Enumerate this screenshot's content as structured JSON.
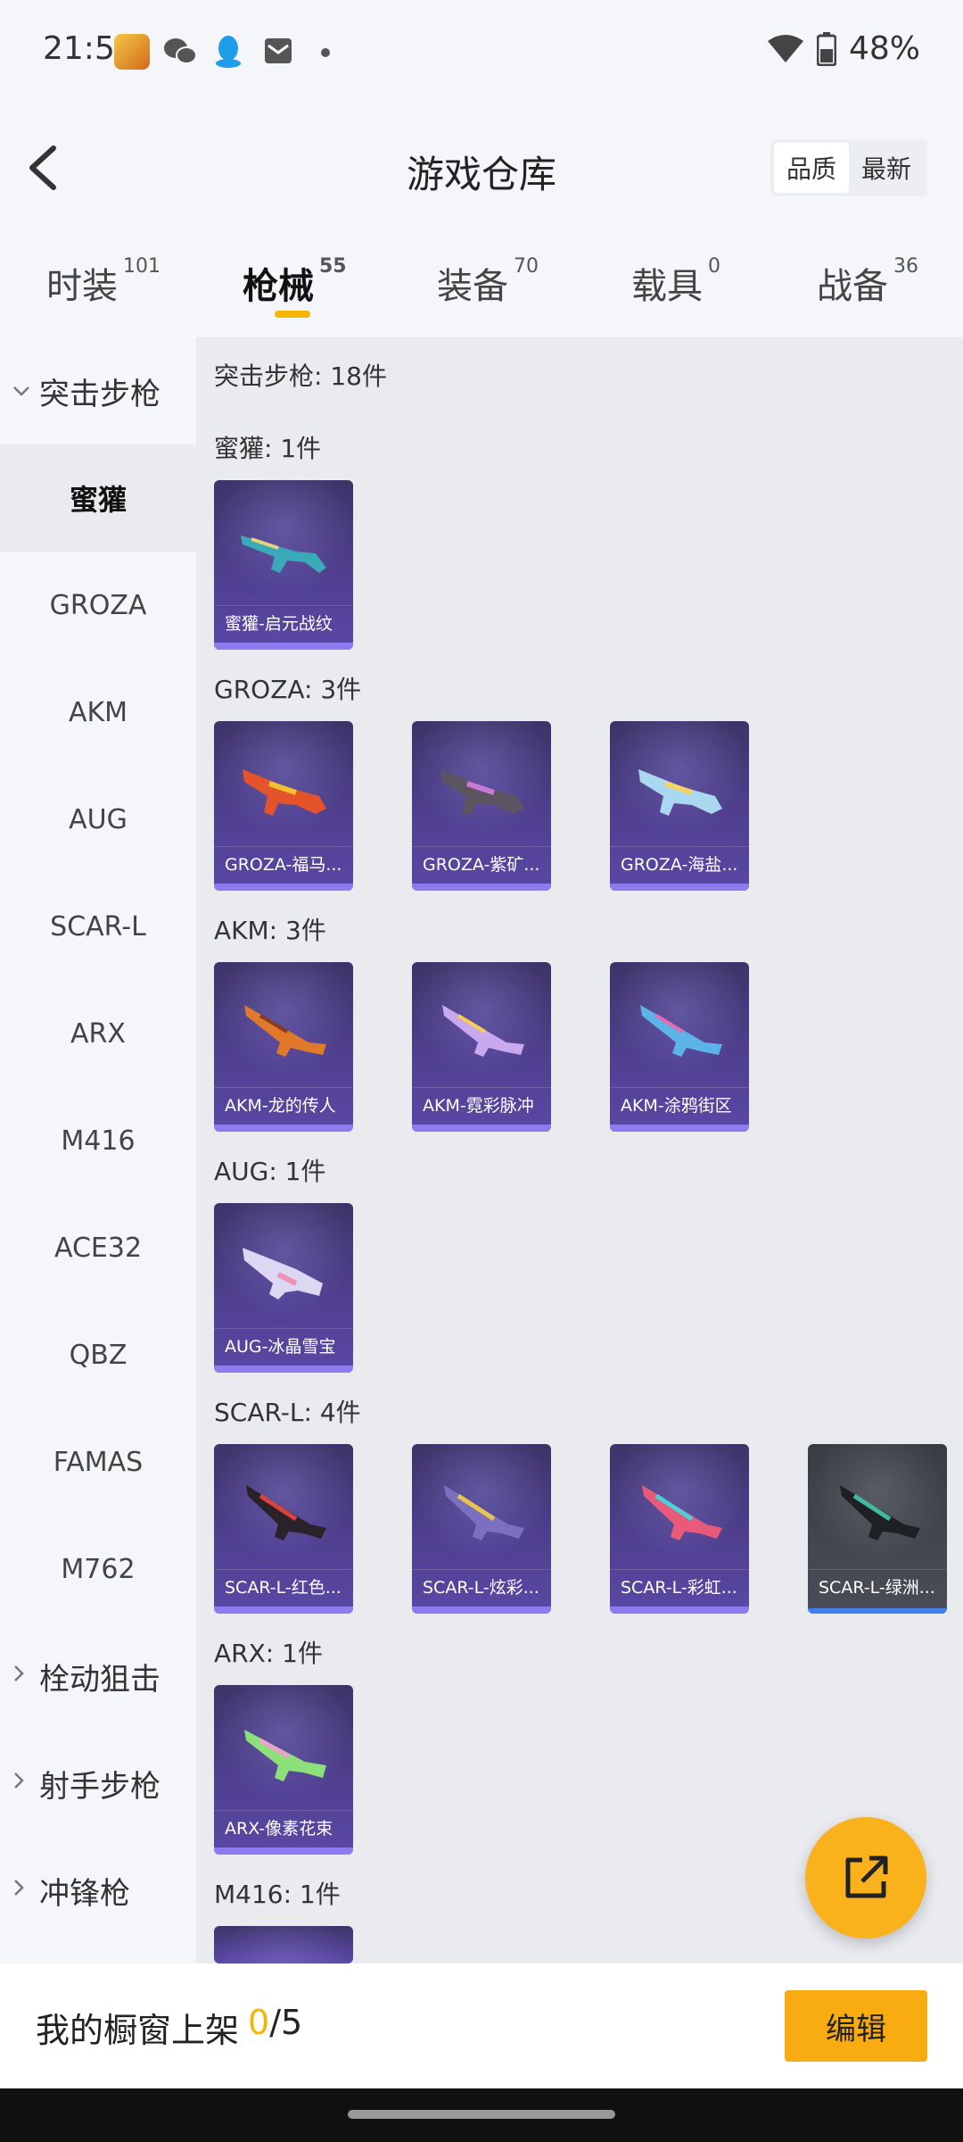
{
  "status_bar": {
    "time": "21:51",
    "battery": "48%"
  },
  "header": {
    "title": "游戏仓库",
    "sort_options": [
      "品质",
      "最新"
    ]
  },
  "tabs": [
    {
      "label": "时装",
      "count": "101"
    },
    {
      "label": "枪械",
      "count": "55"
    },
    {
      "label": "装备",
      "count": "70"
    },
    {
      "label": "载具",
      "count": "0"
    },
    {
      "label": "战备",
      "count": "36"
    }
  ],
  "sidebar": {
    "expanded_category": "突击步枪",
    "sub_items": [
      "蜜獾",
      "GROZA",
      "AKM",
      "AUG",
      "SCAR-L",
      "ARX",
      "M416",
      "ACE32",
      "QBZ",
      "FAMAS",
      "M762"
    ],
    "collapsed_categories": [
      "栓动狙击",
      "射手步枪",
      "冲锋枪"
    ]
  },
  "main": {
    "summary": "突击步枪: 18件",
    "sections": [
      {
        "label": "蜜獾: 1件",
        "items": [
          "蜜獾-启元战纹"
        ]
      },
      {
        "label": "GROZA: 3件",
        "items": [
          "GROZA-福马...",
          "GROZA-紫矿...",
          "GROZA-海盐..."
        ]
      },
      {
        "label": "AKM: 3件",
        "items": [
          "AKM-龙的传人",
          "AKM-霓彩脉冲",
          "AKM-涂鸦街区"
        ]
      },
      {
        "label": "AUG: 1件",
        "items": [
          "AUG-冰晶雪宝"
        ]
      },
      {
        "label": "SCAR-L: 4件",
        "items": [
          "SCAR-L-红色...",
          "SCAR-L-炫彩...",
          "SCAR-L-彩虹...",
          "SCAR-L-绿洲..."
        ]
      },
      {
        "label": "ARX: 1件",
        "items": [
          "ARX-像素花束"
        ]
      },
      {
        "label": "M416: 1件",
        "items": []
      }
    ]
  },
  "bottom": {
    "label": "我的橱窗上架",
    "count": "0",
    "total": "/5",
    "edit_label": "编辑"
  },
  "colors": {
    "accent": "#f7b500",
    "card_purple": "#4f3f8e",
    "fab": "#f9b21c"
  }
}
